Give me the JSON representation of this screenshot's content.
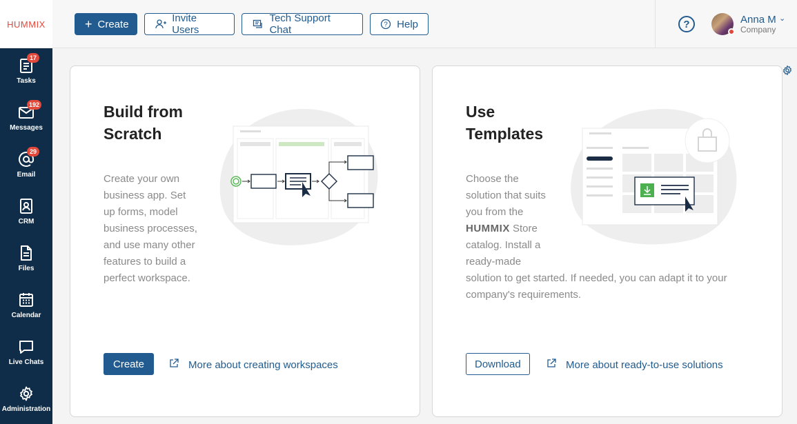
{
  "logo": "HUMMIX",
  "topbar": {
    "create_label": "Create",
    "invite_label": "Invite Users",
    "support_label": "Tech Support Chat",
    "help_label": "Help"
  },
  "user": {
    "name": "Anna M",
    "company": "Company",
    "status_color": "#e2493b"
  },
  "sidebar": {
    "items": [
      {
        "label": "Tasks",
        "icon": "tasks-icon",
        "badge": "17"
      },
      {
        "label": "Messages",
        "icon": "mail-icon",
        "badge": "192"
      },
      {
        "label": "Email",
        "icon": "at-icon",
        "badge": "29"
      },
      {
        "label": "CRM",
        "icon": "contact-card-icon",
        "badge": ""
      },
      {
        "label": "Files",
        "icon": "file-icon",
        "badge": ""
      },
      {
        "label": "Calendar",
        "icon": "calendar-icon",
        "badge": ""
      },
      {
        "label": "Live Chats",
        "icon": "chat-icon",
        "badge": ""
      },
      {
        "label": "Administration",
        "icon": "gear-icon",
        "badge": ""
      }
    ]
  },
  "cards": {
    "scratch": {
      "title_line1": "Build from",
      "title_line2": "Scratch",
      "desc_lines": [
        "Create your own",
        "business app. Set",
        "up forms, model",
        "business processes,",
        "and use many other",
        "features to build a",
        "perfect workspace."
      ],
      "button_label": "Create",
      "link_label": "More about creating workspaces"
    },
    "templates": {
      "title_line1": "Use",
      "title_line2": "Templates",
      "desc_lines": [
        "Choose the",
        "solution that suits",
        "you from the"
      ],
      "store_name": "HUMMIX",
      "store_suffix": " Store",
      "desc_lines_after": [
        "catalog. Install a",
        "ready-made",
        "solution to get started. If needed, you can adapt it to your",
        "company's requirements."
      ],
      "button_label": "Download",
      "link_label": "More about ready-to-use solutions"
    }
  },
  "colors": {
    "accent": "#215b8f",
    "sidebar": "#0f2d48",
    "badge": "#e2493b",
    "green": "#4caf50"
  }
}
